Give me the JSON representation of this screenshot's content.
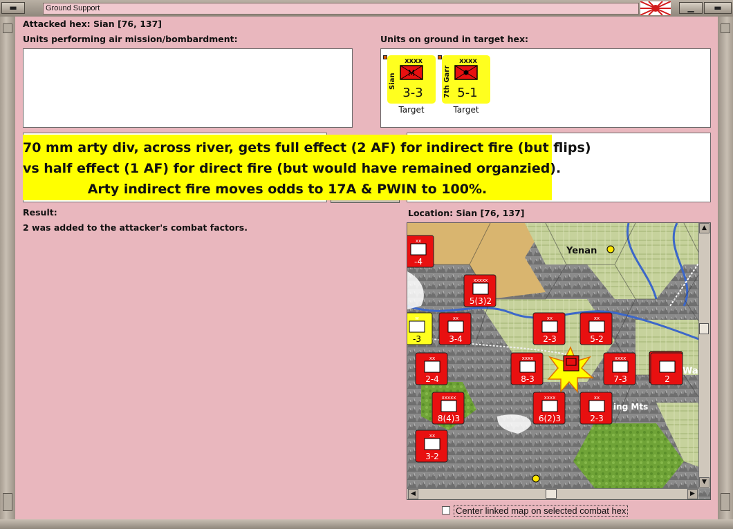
{
  "window": {
    "title": "Ground Support",
    "buttons": [
      "minimize",
      "maximize",
      "close"
    ]
  },
  "attacked_hex": "Attacked hex: Sian  [76, 137]",
  "air_units_label": "Units performing air mission/bombardment:",
  "ground_units_label": "Units on ground in target hex:",
  "ground_units": [
    {
      "name": "Sian",
      "size": "xxxx",
      "symbol": "M",
      "strength": "3-3",
      "role": "Target"
    },
    {
      "name": "7th Garr",
      "size": "xxxx",
      "symbol": "garrison",
      "strength": "5-1",
      "role": "Target"
    }
  ],
  "callout": {
    "lines": [
      "70 mm arty div, across river, gets full effect (2 AF) for indirect fire (but flips)",
      "vs half effect (1 AF) for direct fire (but would have remained organzied).",
      "Arty indirect fire moves odds to 17A & PWIN to 100%."
    ]
  },
  "result_label": "Result:",
  "result_text": "2 was added to the attacker's combat factors.",
  "location_label": "Location:  Sian  [76, 137]",
  "map": {
    "places": [
      "Yenan",
      "ing Mts",
      "Wa"
    ],
    "counters": [
      {
        "label": "xx",
        "strength": "-4",
        "color": "#e81010"
      },
      {
        "label": "xxxxx",
        "strength": "5(3)2",
        "color": "#e81010"
      },
      {
        "label": "xx",
        "strength": "3-4",
        "color": "#e81010"
      },
      {
        "label": "w",
        "strength": "-3",
        "color": "#ffff1f"
      },
      {
        "label": "xx",
        "strength": "2-3",
        "color": "#e81010"
      },
      {
        "label": "xx",
        "strength": "5-2",
        "color": "#e81010"
      },
      {
        "label": "xx",
        "strength": "2-4",
        "color": "#e81010"
      },
      {
        "label": "xxxx",
        "strength": "8-3",
        "color": "#e81010"
      },
      {
        "label": "xxxx",
        "strength": "7-3",
        "color": "#e81010"
      },
      {
        "label": "",
        "strength": "2",
        "color": "#e81010"
      },
      {
        "label": "xxxxx",
        "strength": "8(4)3",
        "color": "#e81010"
      },
      {
        "label": "xxxx",
        "strength": "6(2)3",
        "color": "#e81010"
      },
      {
        "label": "xx",
        "strength": "2-3",
        "color": "#e81010"
      },
      {
        "label": "xx",
        "strength": "3-2",
        "color": "#e81010"
      }
    ]
  },
  "checkbox": {
    "label": "Center linked map on selected combat hex",
    "checked": false
  }
}
